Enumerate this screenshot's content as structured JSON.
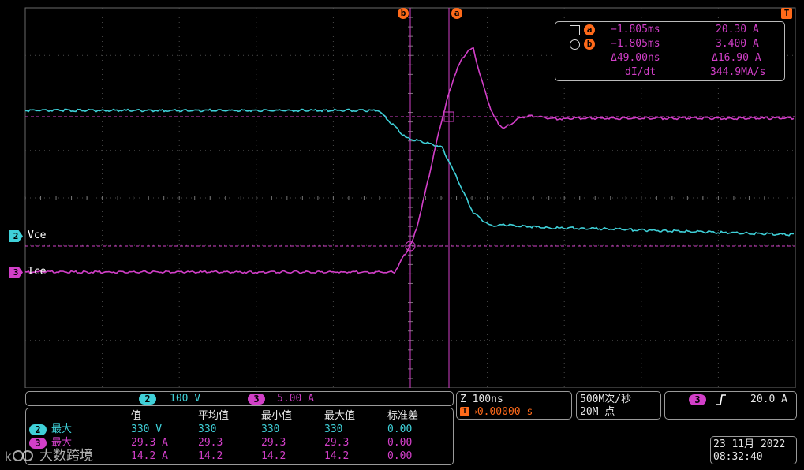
{
  "colors": {
    "ch2": "#3fd0d8",
    "ch3": "#d23fc8",
    "cursor": "#ff6a1a",
    "grid": "#555555"
  },
  "trigger_marker_top": "T",
  "cursors": {
    "b_label": "b",
    "a_label": "a"
  },
  "cursor_readout": {
    "row_a": {
      "marker": "a",
      "time": "−1.805ms",
      "value": "20.30 A"
    },
    "row_b": {
      "marker": "b",
      "time": "−1.805ms",
      "value": "3.400 A"
    },
    "delta_time": "Δ49.00ns",
    "delta_value": "Δ16.90 A",
    "didt_label": "dI/dt",
    "didt_value": "344.9MA/s"
  },
  "channels": {
    "ch2": {
      "number": "2",
      "name": "Vce",
      "scale": "100 V"
    },
    "ch3": {
      "number": "3",
      "name": "Ice",
      "scale": "5.00 A"
    }
  },
  "timebase": {
    "label": "Z 100ns",
    "trigger_icon": "T",
    "position": "→0.00000 s"
  },
  "acquisition": {
    "rate": "500M次/秒",
    "points": "20M 点"
  },
  "trigger": {
    "channel": "3",
    "slope_icon": "rising-edge",
    "level": "20.0 A"
  },
  "measurements": {
    "headers": [
      "值",
      "平均值",
      "最小值",
      "最大值",
      "标准差"
    ],
    "rows": [
      {
        "ch": "2",
        "type": "最大",
        "values": [
          "330 V",
          "330",
          "330",
          "330",
          "0.00"
        ]
      },
      {
        "ch": "3",
        "type": "最大",
        "values": [
          "29.3 A",
          "29.3",
          "29.3",
          "29.3",
          "0.00"
        ]
      },
      {
        "ch": "",
        "type": "",
        "values": [
          "14.2 A",
          "14.2",
          "14.2",
          "14.2",
          "0.00"
        ]
      }
    ]
  },
  "datetime": {
    "date": "23 11月 2022",
    "time": "08:32:40"
  },
  "watermark": "大数跨境"
}
